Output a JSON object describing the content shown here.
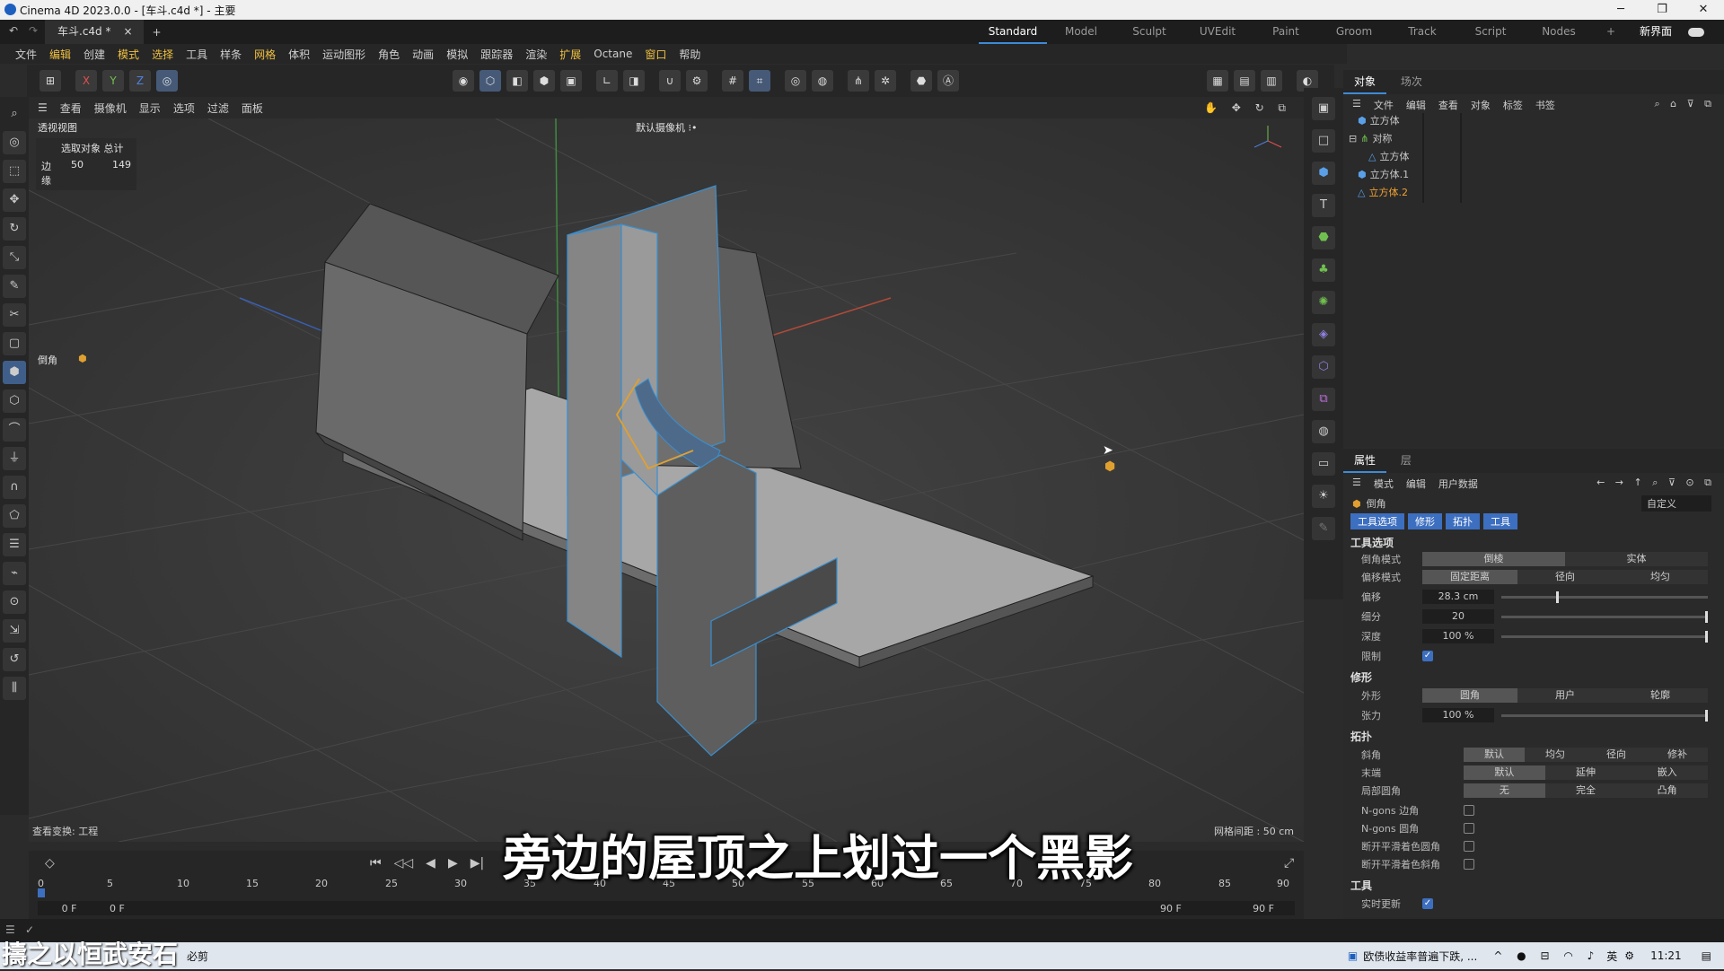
{
  "window": {
    "title": "Cinema 4D 2023.0.0 - [车斗.c4d *] - 主要"
  },
  "doc_tab": {
    "name": "车斗.c4d *",
    "close": "×",
    "add": "+"
  },
  "layouts": [
    "Standard",
    "Model",
    "Sculpt",
    "UVEdit",
    "Paint",
    "Groom",
    "Track",
    "Script",
    "Nodes",
    "+",
    "新界面"
  ],
  "menu": [
    "文件",
    "编辑",
    "创建",
    "模式",
    "选择",
    "工具",
    "样条",
    "网格",
    "体积",
    "运动图形",
    "角色",
    "动画",
    "模拟",
    "跟踪器",
    "渲染",
    "扩展",
    "Octane",
    "窗口",
    "帮助"
  ],
  "toolbar": {
    "axes": [
      "X",
      "Y",
      "Z"
    ]
  },
  "viewport_menu": [
    "查看",
    "摄像机",
    "显示",
    "选项",
    "过滤",
    "面板"
  ],
  "viewport": {
    "name": "透视视图",
    "camera": "默认摄像机 ⁝•",
    "stats_header": "选取对象 总计",
    "stats_label": "边缘",
    "stats_selected": "50",
    "stats_total": "149",
    "tool_label": "倒角",
    "transform": "查看变换: 工程",
    "grid": "网格间距 : 50 cm"
  },
  "subtitle": "旁边的屋顶之上划过一个黑影",
  "watermark": "擣之以恒武安石",
  "timeline": {
    "ticks": [
      "0",
      "5",
      "10",
      "15",
      "20",
      "25",
      "30",
      "35",
      "40",
      "45",
      "50",
      "55",
      "60",
      "65",
      "70",
      "75",
      "80",
      "85",
      "90"
    ],
    "start": "0 F",
    "start2": "0 F",
    "end": "90 F",
    "end2": "90 F"
  },
  "objects_panel": {
    "tabs": [
      "对象",
      "场次"
    ],
    "menu": [
      "文件",
      "编辑",
      "查看",
      "对象",
      "标签",
      "书签"
    ],
    "items": [
      {
        "name": "立方体",
        "indent": 0,
        "selected": false
      },
      {
        "name": "对称",
        "indent": 0,
        "selected": false
      },
      {
        "name": "立方体",
        "indent": 1,
        "selected": false
      },
      {
        "name": "立方体.1",
        "indent": 0,
        "selected": false
      },
      {
        "name": "立方体.2",
        "indent": 0,
        "selected": true
      }
    ]
  },
  "attributes_panel": {
    "tabs": [
      "属性",
      "层"
    ],
    "menu": [
      "模式",
      "编辑",
      "用户数据"
    ],
    "tool_name": "倒角",
    "preset": "自定义",
    "subtabs": [
      "工具选项",
      "修形",
      "拓扑",
      "工具"
    ],
    "section_tool_options": "工具选项",
    "bevel_mode_label": "倒角模式",
    "bevel_mode_options": [
      "倒棱",
      "实体"
    ],
    "offset_mode_label": "偏移模式",
    "offset_mode_options": [
      "固定距离",
      "径向",
      "均匀"
    ],
    "offset_label": "偏移",
    "offset_value": "28.3 cm",
    "offset_level": 0.28,
    "subdiv_label": "细分",
    "subdiv_value": "20",
    "subdiv_level": 1.0,
    "depth_label": "深度",
    "depth_value": "100 %",
    "depth_level": 1.0,
    "limit_label": "限制",
    "limit_checked": true,
    "section_shaping": "修形",
    "shape_label": "外形",
    "shape_options": [
      "圆角",
      "用户",
      "轮廓"
    ],
    "tension_label": "张力",
    "tension_value": "100 %",
    "tension_level": 1.0,
    "section_topology": "拓扑",
    "miter_label": "斜角",
    "miter_options": [
      "默认",
      "均匀",
      "径向",
      "修补"
    ],
    "end_label": "末端",
    "end_options": [
      "默认",
      "延伸",
      "嵌入"
    ],
    "partial_label": "局部圆角",
    "partial_options": [
      "无",
      "完全",
      "凸角"
    ],
    "ngons_corner": "N-gons 边角",
    "ngons_round": "N-gons 圆角",
    "break_phong_round": "断开平滑着色圆角",
    "break_phong_miter": "断开平滑着色斜角",
    "section_tool": "工具",
    "realtime_label": "实时更新"
  },
  "taskbar": {
    "news": "欧债收益率普遍下跌, ...",
    "ime": "英",
    "time": "11:21",
    "app": "必剪"
  }
}
